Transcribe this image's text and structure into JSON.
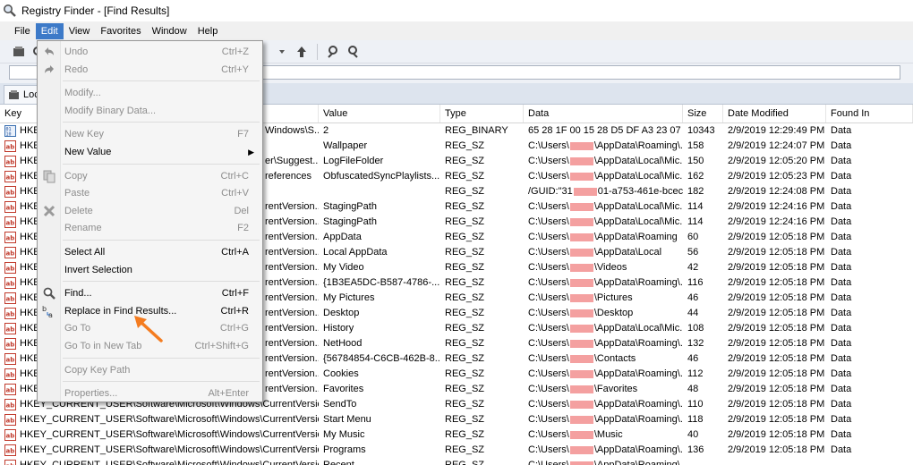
{
  "window": {
    "title": "Registry Finder - [Find Results]"
  },
  "menubar": {
    "items": [
      "File",
      "Edit",
      "View",
      "Favorites",
      "Window",
      "Help"
    ],
    "active": "Edit"
  },
  "tab": {
    "label_fragment": "Loc"
  },
  "columns": [
    "Key",
    "Value",
    "Type",
    "Data",
    "Size",
    "Date Modified",
    "Found In"
  ],
  "rows": [
    {
      "key": "HKEY",
      "key_tail": "Windows\\S...",
      "value": "2",
      "type": "REG_BINARY",
      "data": "65 28 1F 00 15 28 D5 DF A3 23 07 2...",
      "size": "10343",
      "date": "2/9/2019 12:29:49 PM",
      "found": "Data",
      "icon": "binary"
    },
    {
      "key": "HKE",
      "key_tail": "",
      "value": "Wallpaper",
      "type": "REG_SZ",
      "data": "C:\\Users\\▇▇▇\\AppData\\Roaming\\...",
      "size": "158",
      "date": "2/9/2019 12:24:07 PM",
      "found": "Data",
      "icon": "string"
    },
    {
      "key": "HKE",
      "key_tail": "er\\Suggest...",
      "value": "LogFileFolder",
      "type": "REG_SZ",
      "data": "C:\\Users\\▇▇▇\\AppData\\Local\\Mic...",
      "size": "150",
      "date": "2/9/2019 12:05:20 PM",
      "found": "Data",
      "icon": "string"
    },
    {
      "key": "HKE",
      "key_tail": "references",
      "value": "ObfuscatedSyncPlaylists...",
      "type": "REG_SZ",
      "data": "C:\\Users\\▇▇▇\\AppData\\Local\\Mic...",
      "size": "162",
      "date": "2/9/2019 12:05:23 PM",
      "found": "Data",
      "icon": "string"
    },
    {
      "key": "HKE",
      "key_tail": "",
      "value": "",
      "type": "REG_SZ",
      "data": "/GUID:\"31▇▇▇01-a753-461e-bcec...",
      "size": "182",
      "date": "2/9/2019 12:24:08 PM",
      "found": "Data",
      "icon": "string"
    },
    {
      "key": "HKE",
      "key_tail": "rentVersion...",
      "value": "StagingPath",
      "type": "REG_SZ",
      "data": "C:\\Users\\▇▇▇\\AppData\\Local\\Mic...",
      "size": "114",
      "date": "2/9/2019 12:24:16 PM",
      "found": "Data",
      "icon": "string"
    },
    {
      "key": "HKE",
      "key_tail": "rentVersion...",
      "value": "StagingPath",
      "type": "REG_SZ",
      "data": "C:\\Users\\▇▇▇\\AppData\\Local\\Mic...",
      "size": "114",
      "date": "2/9/2019 12:24:16 PM",
      "found": "Data",
      "icon": "string"
    },
    {
      "key": "HKE",
      "key_tail": "rentVersion...",
      "value": "AppData",
      "type": "REG_SZ",
      "data": "C:\\Users\\▇▇▇\\AppData\\Roaming",
      "size": "60",
      "date": "2/9/2019 12:05:18 PM",
      "found": "Data",
      "icon": "string"
    },
    {
      "key": "HKE",
      "key_tail": "rentVersion...",
      "value": "Local AppData",
      "type": "REG_SZ",
      "data": "C:\\Users\\▇▇▇\\AppData\\Local",
      "size": "56",
      "date": "2/9/2019 12:05:18 PM",
      "found": "Data",
      "icon": "string"
    },
    {
      "key": "HKE",
      "key_tail": "rentVersion...",
      "value": "My Video",
      "type": "REG_SZ",
      "data": "C:\\Users\\▇▇▇\\Videos",
      "size": "42",
      "date": "2/9/2019 12:05:18 PM",
      "found": "Data",
      "icon": "string"
    },
    {
      "key": "HKE",
      "key_tail": "rentVersion...",
      "value": "{1B3EA5DC-B587-4786-...",
      "type": "REG_SZ",
      "data": "C:\\Users\\▇▇▇\\AppData\\Roaming\\...",
      "size": "116",
      "date": "2/9/2019 12:05:18 PM",
      "found": "Data",
      "icon": "string"
    },
    {
      "key": "HKE",
      "key_tail": "rentVersion...",
      "value": "My Pictures",
      "type": "REG_SZ",
      "data": "C:\\Users\\▇▇▇\\Pictures",
      "size": "46",
      "date": "2/9/2019 12:05:18 PM",
      "found": "Data",
      "icon": "string"
    },
    {
      "key": "HKE",
      "key_tail": "rentVersion...",
      "value": "Desktop",
      "type": "REG_SZ",
      "data": "C:\\Users\\▇▇▇\\Desktop",
      "size": "44",
      "date": "2/9/2019 12:05:18 PM",
      "found": "Data",
      "icon": "string"
    },
    {
      "key": "HKE",
      "key_tail": "rentVersion...",
      "value": "History",
      "type": "REG_SZ",
      "data": "C:\\Users\\▇▇▇\\AppData\\Local\\Mic...",
      "size": "108",
      "date": "2/9/2019 12:05:18 PM",
      "found": "Data",
      "icon": "string"
    },
    {
      "key": "HKE",
      "key_tail": "rentVersion...",
      "value": "NetHood",
      "type": "REG_SZ",
      "data": "C:\\Users\\▇▇▇\\AppData\\Roaming\\...",
      "size": "132",
      "date": "2/9/2019 12:05:18 PM",
      "found": "Data",
      "icon": "string"
    },
    {
      "key": "HKE",
      "key_tail": "rentVersion...",
      "value": "{56784854-C6CB-462B-8...",
      "type": "REG_SZ",
      "data": "C:\\Users\\▇▇▇\\Contacts",
      "size": "46",
      "date": "2/9/2019 12:05:18 PM",
      "found": "Data",
      "icon": "string"
    },
    {
      "key": "HKE",
      "key_tail": "rentVersion...",
      "value": "Cookies",
      "type": "REG_SZ",
      "data": "C:\\Users\\▇▇▇\\AppData\\Roaming\\...",
      "size": "112",
      "date": "2/9/2019 12:05:18 PM",
      "found": "Data",
      "icon": "string"
    },
    {
      "key": "HKE",
      "key_tail": "rentVersion...",
      "value": "Favorites",
      "type": "REG_SZ",
      "data": "C:\\Users\\▇▇▇\\Favorites",
      "size": "48",
      "date": "2/9/2019 12:05:18 PM",
      "found": "Data",
      "icon": "string"
    },
    {
      "key": "HKEY_CURRENT_USER\\Software\\Microsoft\\Windows\\CurrentVersion...",
      "key_tail": "",
      "value": "SendTo",
      "type": "REG_SZ",
      "data": "C:\\Users\\▇▇▇\\AppData\\Roaming\\...",
      "size": "110",
      "date": "2/9/2019 12:05:18 PM",
      "found": "Data",
      "icon": "string"
    },
    {
      "key": "HKEY_CURRENT_USER\\Software\\Microsoft\\Windows\\CurrentVersion...",
      "key_tail": "",
      "value": "Start Menu",
      "type": "REG_SZ",
      "data": "C:\\Users\\▇▇▇\\AppData\\Roaming\\...",
      "size": "118",
      "date": "2/9/2019 12:05:18 PM",
      "found": "Data",
      "icon": "string"
    },
    {
      "key": "HKEY_CURRENT_USER\\Software\\Microsoft\\Windows\\CurrentVersion...",
      "key_tail": "",
      "value": "My Music",
      "type": "REG_SZ",
      "data": "C:\\Users\\▇▇▇\\Music",
      "size": "40",
      "date": "2/9/2019 12:05:18 PM",
      "found": "Data",
      "icon": "string"
    },
    {
      "key": "HKEY_CURRENT_USER\\Software\\Microsoft\\Windows\\CurrentVersion...",
      "key_tail": "",
      "value": "Programs",
      "type": "REG_SZ",
      "data": "C:\\Users\\▇▇▇\\AppData\\Roaming\\...",
      "size": "136",
      "date": "2/9/2019 12:05:18 PM",
      "found": "Data",
      "icon": "string"
    },
    {
      "key": "HKEY_CURRENT_USER\\Software\\Microsoft\\Windows\\CurrentVersion...",
      "key_tail": "",
      "value": "Recent",
      "type": "REG_SZ",
      "data": "C:\\Users\\▇▇▇\\AppData\\Roaming\\...",
      "size": "",
      "date": "",
      "found": "",
      "icon": "string"
    }
  ],
  "edit_menu": [
    {
      "kind": "item",
      "label": "Undo",
      "shortcut": "Ctrl+Z",
      "disabled": true,
      "icon": "undo-icon"
    },
    {
      "kind": "item",
      "label": "Redo",
      "shortcut": "Ctrl+Y",
      "disabled": true,
      "icon": "redo-icon"
    },
    {
      "kind": "sep"
    },
    {
      "kind": "item",
      "label": "Modify...",
      "shortcut": "",
      "disabled": true,
      "icon": ""
    },
    {
      "kind": "item",
      "label": "Modify Binary Data...",
      "shortcut": "",
      "disabled": true,
      "icon": ""
    },
    {
      "kind": "sep"
    },
    {
      "kind": "item",
      "label": "New Key",
      "shortcut": "F7",
      "disabled": true,
      "icon": ""
    },
    {
      "kind": "item",
      "label": "New Value",
      "shortcut": "",
      "disabled": false,
      "icon": "",
      "submenu": true
    },
    {
      "kind": "sep"
    },
    {
      "kind": "item",
      "label": "Copy",
      "shortcut": "Ctrl+C",
      "disabled": true,
      "icon": "copy-icon"
    },
    {
      "kind": "item",
      "label": "Paste",
      "shortcut": "Ctrl+V",
      "disabled": true,
      "icon": ""
    },
    {
      "kind": "item",
      "label": "Delete",
      "shortcut": "Del",
      "disabled": true,
      "icon": "delete-icon"
    },
    {
      "kind": "item",
      "label": "Rename",
      "shortcut": "F2",
      "disabled": true,
      "icon": ""
    },
    {
      "kind": "sep"
    },
    {
      "kind": "item",
      "label": "Select All",
      "shortcut": "Ctrl+A",
      "disabled": false,
      "icon": ""
    },
    {
      "kind": "item",
      "label": "Invert Selection",
      "shortcut": "",
      "disabled": false,
      "icon": ""
    },
    {
      "kind": "sep"
    },
    {
      "kind": "item",
      "label": "Find...",
      "shortcut": "Ctrl+F",
      "disabled": false,
      "icon": "find-icon"
    },
    {
      "kind": "item",
      "label": "Replace in Find Results...",
      "shortcut": "Ctrl+R",
      "disabled": false,
      "icon": "replace-icon"
    },
    {
      "kind": "item",
      "label": "Go To",
      "shortcut": "Ctrl+G",
      "disabled": true,
      "icon": ""
    },
    {
      "kind": "item",
      "label": "Go To in New Tab",
      "shortcut": "Ctrl+Shift+G",
      "disabled": true,
      "icon": ""
    },
    {
      "kind": "sep"
    },
    {
      "kind": "item",
      "label": "Copy Key Path",
      "shortcut": "",
      "disabled": true,
      "icon": ""
    },
    {
      "kind": "sep"
    },
    {
      "kind": "item",
      "label": "Properties...",
      "shortcut": "Alt+Enter",
      "disabled": true,
      "icon": ""
    }
  ],
  "colors": {
    "menu_highlight": "#3d7ac8",
    "annotation_arrow": "#f47c20",
    "redaction": "#f4a0a0"
  }
}
